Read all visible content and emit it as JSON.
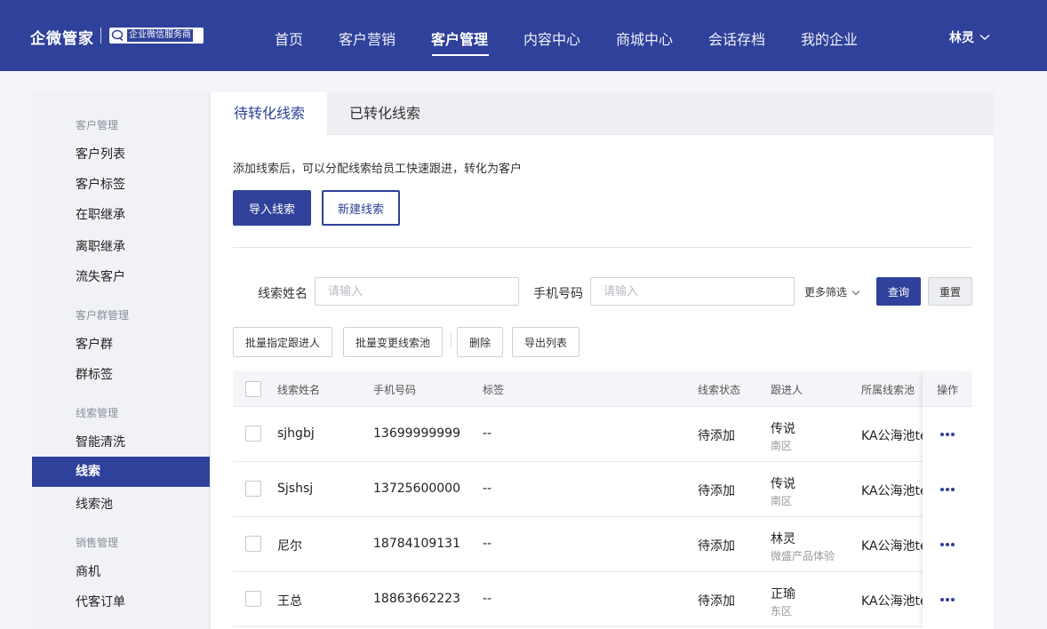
{
  "header": {
    "brand": "企微管家",
    "badge": "企业微信服务商",
    "nav": [
      "首页",
      "客户营销",
      "客户管理",
      "内容中心",
      "商城中心",
      "会话存档",
      "我的企业"
    ],
    "active_nav": "客户管理",
    "user": "林灵"
  },
  "sidebar": {
    "groups": [
      {
        "title": "客户管理",
        "items": [
          "客户列表",
          "客户标签",
          "在职继承",
          "离职继承",
          "流失客户"
        ]
      },
      {
        "title": "客户群管理",
        "items": [
          "客户群",
          "群标签"
        ]
      },
      {
        "title": "线索管理",
        "items": [
          "智能清洗",
          "线索",
          "线索池"
        ]
      },
      {
        "title": "销售管理",
        "items": [
          "商机",
          "代客订单"
        ]
      }
    ],
    "active_item": "线索"
  },
  "tabs": [
    "待转化线索",
    "已转化线索"
  ],
  "hint": "添加线索后，可以分配线索给员工快速跟进，转化为客户",
  "actions": {
    "import": "导入线索",
    "create": "新建线索"
  },
  "filters": {
    "name_label": "线索姓名",
    "name_placeholder": "请输入",
    "phone_label": "手机号码",
    "phone_placeholder": "请输入",
    "more": "更多筛选",
    "query": "查询",
    "reset": "重置"
  },
  "bulk": {
    "assign": "批量指定跟进人",
    "change_pool": "批量变更线索池",
    "delete": "删除",
    "export": "导出列表"
  },
  "table": {
    "columns": [
      "线索姓名",
      "手机号码",
      "标签",
      "线索状态",
      "跟进人",
      "所属线索池",
      "操作"
    ],
    "rows": [
      {
        "name": "sjhgbj",
        "phone": "13699999999",
        "tag": "--",
        "status": "待添加",
        "owner": "传说",
        "dept": "南区",
        "pool": "KA公海池te"
      },
      {
        "name": "Sjshsj",
        "phone": "13725600000",
        "tag": "--",
        "status": "待添加",
        "owner": "传说",
        "dept": "南区",
        "pool": "KA公海池te"
      },
      {
        "name": "尼尔",
        "phone": "18784109131",
        "tag": "--",
        "status": "待添加",
        "owner": "林灵",
        "dept": "微盛产品体验",
        "pool": "KA公海池te"
      },
      {
        "name": "王总",
        "phone": "18863662223",
        "tag": "--",
        "status": "待添加",
        "owner": "正瑜",
        "dept": "东区",
        "pool": "KA公海池te"
      }
    ]
  },
  "colors": {
    "primary": "#2f419a",
    "page_bg": "#f3f5f9"
  }
}
